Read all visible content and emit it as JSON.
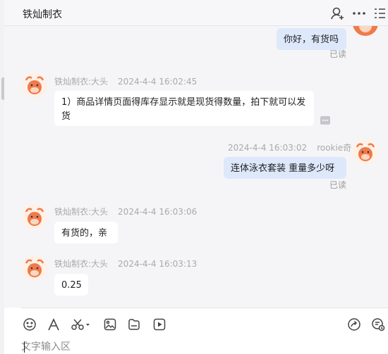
{
  "header": {
    "title": "铁灿制衣",
    "icons": [
      "add-user-icon",
      "more-icon",
      "menu-list-icon"
    ]
  },
  "messages": [
    {
      "direction": "out",
      "text": "你好，有货吗",
      "status": "已读"
    },
    {
      "direction": "in",
      "sender": "铁灿制衣:大头",
      "time": "2024-4-4 16:02:45",
      "text": "1）商品详情页面得库存显示就是现货得数量，拍下就可以发货"
    },
    {
      "direction": "out",
      "sender": "rookie奇",
      "time": "2024-4-4 16:03:02",
      "text": "连体泳衣套装  重量多少呀",
      "status": "已读"
    },
    {
      "direction": "in",
      "sender": "铁灿制衣:大头",
      "time": "2024-4-4 16:03:06",
      "text": "有货的，亲"
    },
    {
      "direction": "in",
      "sender": "铁灿制衣:大头",
      "time": "2024-4-4 16:03:13",
      "text": "0.25"
    }
  ],
  "toolbar": {
    "tools": [
      "emoji-icon",
      "font-icon",
      "scissors-icon",
      "image-icon",
      "file-icon",
      "video-icon",
      "share-icon",
      "quick-reply-icon"
    ]
  },
  "input": {
    "placeholder": "文字输入区"
  },
  "colors": {
    "outgoing_bubble": "#dde8fb",
    "incoming_bubble": "#ffffff",
    "avatar": "#f07a4a"
  }
}
